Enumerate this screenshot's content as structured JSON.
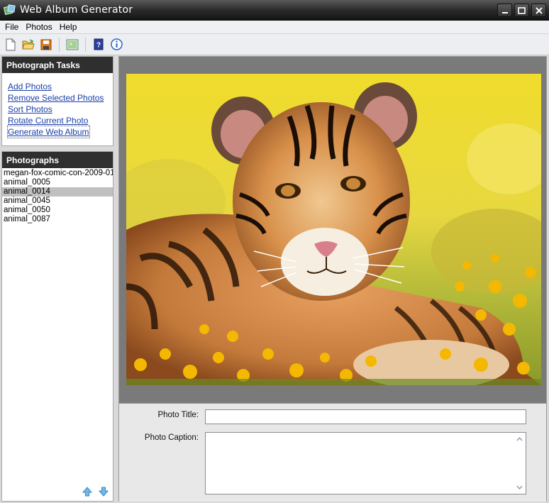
{
  "window": {
    "title": "Web Album Generator"
  },
  "menu": {
    "items": [
      "File",
      "Photos",
      "Help"
    ]
  },
  "tasks": {
    "header": "Photograph Tasks",
    "items": [
      "Add Photos",
      "Remove Selected Photos",
      "Sort Photos",
      "Rotate Current Photo",
      "Generate Web Album"
    ]
  },
  "photographs": {
    "header": "Photographs",
    "items": [
      "megan-fox-comic-con-2009-01",
      "animal_0005",
      "animal_0014",
      "animal_0045",
      "animal_0050",
      "animal_0087"
    ],
    "selected": "animal_0014"
  },
  "form": {
    "title_label": "Photo Title:",
    "title_value": "",
    "caption_label": "Photo Caption:",
    "caption_value": ""
  },
  "icons": {
    "toolbar": [
      "new-file-icon",
      "open-folder-icon",
      "save-icon",
      "image-icon",
      "help-book-icon",
      "info-icon"
    ],
    "arrows": [
      "move-up-icon",
      "move-down-icon"
    ]
  },
  "colors": {
    "link": "#1a3ea8",
    "panel_header": "#2f2f2f",
    "selection": "#c0c0c0"
  }
}
